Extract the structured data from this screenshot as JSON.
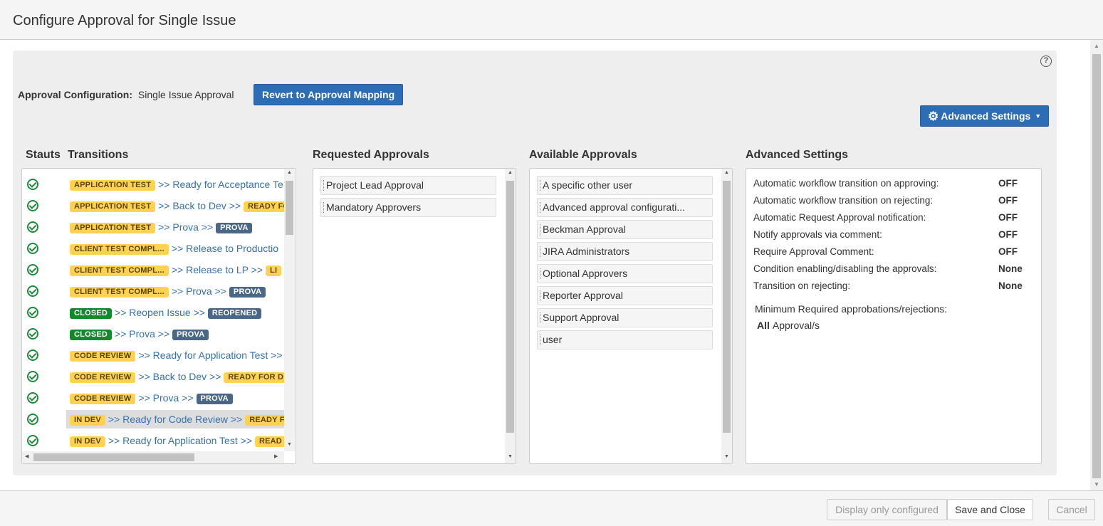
{
  "dialog": {
    "title": "Configure Approval for Single Issue"
  },
  "config": {
    "label": "Approval Configuration:",
    "value": "Single Issue Approval",
    "revert_button": "Revert to Approval Mapping",
    "advanced_button": "Advanced Settings",
    "help_icon": "?"
  },
  "columns": {
    "status": "Stauts",
    "transitions": "Transitions",
    "requested": "Requested Approvals",
    "available": "Available Approvals",
    "advanced": "Advanced Settings"
  },
  "transitions": [
    {
      "from": "APPLICATION TEST",
      "from_color": "yellow",
      "name": ">> Ready for Acceptance Te",
      "to": "",
      "to_color": ""
    },
    {
      "from": "APPLICATION TEST",
      "from_color": "yellow",
      "name": ">> Back to Dev >>",
      "to": "READY FO",
      "to_color": "yellow"
    },
    {
      "from": "APPLICATION TEST",
      "from_color": "yellow",
      "name": ">> Prova >>",
      "to": "PROVA",
      "to_color": "blue"
    },
    {
      "from": "CLIENT TEST COMPL...",
      "from_color": "yellow",
      "name": ">> Release to Productio",
      "to": "",
      "to_color": ""
    },
    {
      "from": "CLIENT TEST COMPL...",
      "from_color": "yellow",
      "name": ">> Release to LP >>",
      "to": "LI",
      "to_color": "yellow"
    },
    {
      "from": "CLIENT TEST COMPL...",
      "from_color": "yellow",
      "name": ">> Prova >>",
      "to": "PROVA",
      "to_color": "blue"
    },
    {
      "from": "CLOSED",
      "from_color": "green",
      "name": ">> Reopen Issue >>",
      "to": "REOPENED",
      "to_color": "blue"
    },
    {
      "from": "CLOSED",
      "from_color": "green",
      "name": ">> Prova >>",
      "to": "PROVA",
      "to_color": "blue"
    },
    {
      "from": "CODE REVIEW",
      "from_color": "yellow",
      "name": ">> Ready for Application Test >>",
      "to": "",
      "to_color": ""
    },
    {
      "from": "CODE REVIEW",
      "from_color": "yellow",
      "name": ">> Back to Dev >>",
      "to": "READY FOR DE",
      "to_color": "yellow"
    },
    {
      "from": "CODE REVIEW",
      "from_color": "yellow",
      "name": ">> Prova >>",
      "to": "PROVA",
      "to_color": "blue"
    },
    {
      "from": "IN DEV",
      "from_color": "yellow",
      "name": ">> Ready for Code Review >>",
      "to": "READY F",
      "to_color": "yellow",
      "highlighted": true
    },
    {
      "from": "IN DEV",
      "from_color": "yellow",
      "name": ">> Ready for Application Test >>",
      "to": "READ",
      "to_color": "yellow"
    }
  ],
  "requested_approvals": [
    "Project Lead Approval",
    "Mandatory Approvers"
  ],
  "available_approvals": [
    "A specific other user",
    "Advanced approval configurati...",
    "Beckman Approval",
    "JIRA Administrators",
    "Optional Approvers",
    "Reporter Approval",
    "Support Approval",
    "user"
  ],
  "advanced_settings": {
    "rows": [
      {
        "label": "Automatic workflow transition on approving:",
        "value": "OFF"
      },
      {
        "label": "Automatic workflow transition on rejecting:",
        "value": "OFF"
      },
      {
        "label": "Automatic Request Approval notification:",
        "value": "OFF"
      },
      {
        "label": "Notify approvals via comment:",
        "value": "OFF"
      },
      {
        "label": "Require Approval Comment:",
        "value": "OFF"
      },
      {
        "label": "Condition enabling/disabling the approvals:",
        "value": "None"
      },
      {
        "label": "Transition on rejecting:",
        "value": "None"
      }
    ],
    "min_required_label": "Minimum Required approbations/rejections:",
    "min_required_value": "All",
    "min_required_suffix": "Approval/s"
  },
  "footer": {
    "display_only": "Display only configured",
    "save": "Save and Close",
    "cancel": "Cancel"
  }
}
